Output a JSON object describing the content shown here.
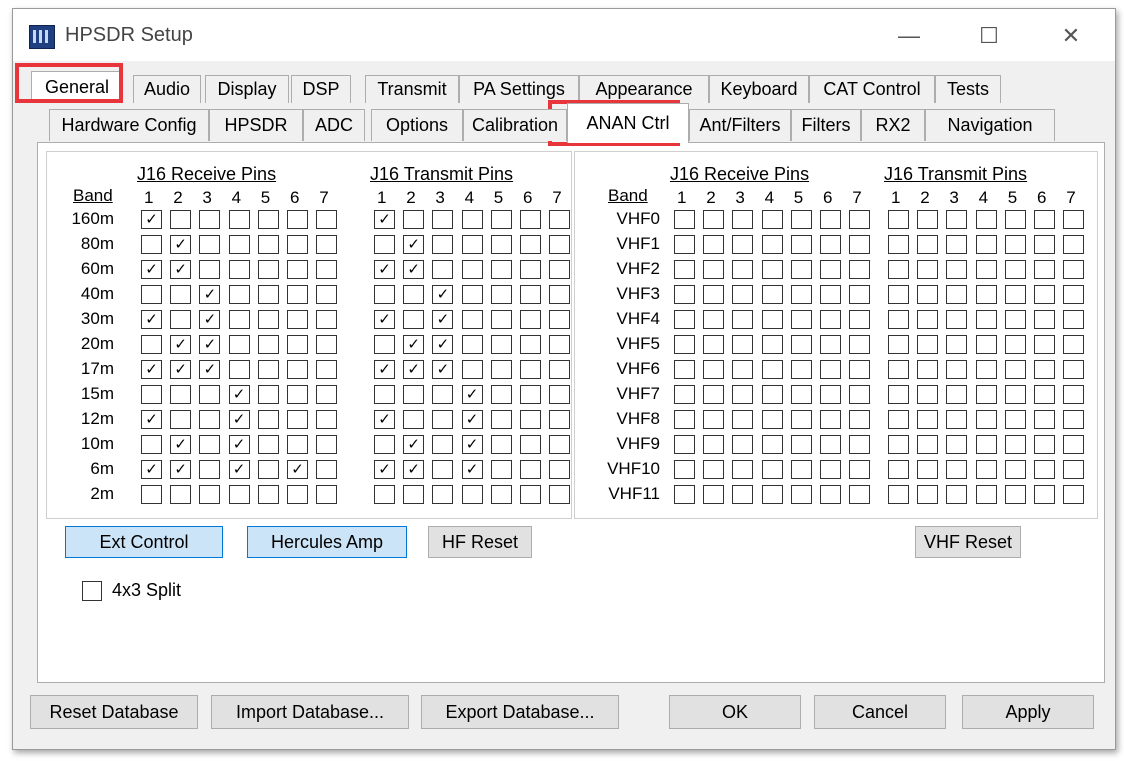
{
  "window": {
    "title": "HPSDR Setup",
    "minimize": "—",
    "maximize": "☐",
    "close": "✕"
  },
  "tabs_row1": [
    {
      "label": "General",
      "selected": true
    },
    {
      "label": "Audio"
    },
    {
      "label": "Display"
    },
    {
      "label": "DSP"
    },
    {
      "label": "Transmit"
    },
    {
      "label": "PA Settings"
    },
    {
      "label": "Appearance"
    },
    {
      "label": "Keyboard"
    },
    {
      "label": "CAT Control"
    },
    {
      "label": "Tests"
    }
  ],
  "tabs_row2": [
    {
      "label": "Hardware Config"
    },
    {
      "label": "HPSDR"
    },
    {
      "label": "ADC"
    },
    {
      "label": "Options"
    },
    {
      "label": "Calibration"
    },
    {
      "label": "ANAN Ctrl",
      "selected": true
    },
    {
      "label": "Ant/Filters"
    },
    {
      "label": "Filters"
    },
    {
      "label": "RX2"
    },
    {
      "label": "Navigation"
    }
  ],
  "hf": {
    "receive_title": "J16 Receive Pins",
    "transmit_title": "J16 Transmit Pins",
    "band_header": "Band",
    "pins": [
      "1",
      "2",
      "3",
      "4",
      "5",
      "6",
      "7"
    ],
    "bands": [
      {
        "name": "160m",
        "rx": [
          1,
          0,
          0,
          0,
          0,
          0,
          0
        ],
        "tx": [
          1,
          0,
          0,
          0,
          0,
          0,
          0
        ]
      },
      {
        "name": "80m",
        "rx": [
          0,
          1,
          0,
          0,
          0,
          0,
          0
        ],
        "tx": [
          0,
          1,
          0,
          0,
          0,
          0,
          0
        ]
      },
      {
        "name": "60m",
        "rx": [
          1,
          1,
          0,
          0,
          0,
          0,
          0
        ],
        "tx": [
          1,
          1,
          0,
          0,
          0,
          0,
          0
        ]
      },
      {
        "name": "40m",
        "rx": [
          0,
          0,
          1,
          0,
          0,
          0,
          0
        ],
        "tx": [
          0,
          0,
          1,
          0,
          0,
          0,
          0
        ]
      },
      {
        "name": "30m",
        "rx": [
          1,
          0,
          1,
          0,
          0,
          0,
          0
        ],
        "tx": [
          1,
          0,
          1,
          0,
          0,
          0,
          0
        ]
      },
      {
        "name": "20m",
        "rx": [
          0,
          1,
          1,
          0,
          0,
          0,
          0
        ],
        "tx": [
          0,
          1,
          1,
          0,
          0,
          0,
          0
        ]
      },
      {
        "name": "17m",
        "rx": [
          1,
          1,
          1,
          0,
          0,
          0,
          0
        ],
        "tx": [
          1,
          1,
          1,
          0,
          0,
          0,
          0
        ]
      },
      {
        "name": "15m",
        "rx": [
          0,
          0,
          0,
          1,
          0,
          0,
          0
        ],
        "tx": [
          0,
          0,
          0,
          1,
          0,
          0,
          0
        ]
      },
      {
        "name": "12m",
        "rx": [
          1,
          0,
          0,
          1,
          0,
          0,
          0
        ],
        "tx": [
          1,
          0,
          0,
          1,
          0,
          0,
          0
        ]
      },
      {
        "name": "10m",
        "rx": [
          0,
          1,
          0,
          1,
          0,
          0,
          0
        ],
        "tx": [
          0,
          1,
          0,
          1,
          0,
          0,
          0
        ]
      },
      {
        "name": "6m",
        "rx": [
          1,
          1,
          0,
          1,
          0,
          1,
          0
        ],
        "tx": [
          1,
          1,
          0,
          1,
          0,
          0,
          0
        ]
      },
      {
        "name": "2m",
        "rx": [
          0,
          0,
          0,
          0,
          0,
          0,
          0
        ],
        "tx": [
          0,
          0,
          0,
          0,
          0,
          0,
          0
        ]
      }
    ]
  },
  "vhf": {
    "receive_title": "J16 Receive Pins",
    "transmit_title": "J16 Transmit Pins",
    "band_header": "Band",
    "pins": [
      "1",
      "2",
      "3",
      "4",
      "5",
      "6",
      "7"
    ],
    "bands": [
      "VHF0",
      "VHF1",
      "VHF2",
      "VHF3",
      "VHF4",
      "VHF5",
      "VHF6",
      "VHF7",
      "VHF8",
      "VHF9",
      "VHF10",
      "VHF11"
    ]
  },
  "buttons": {
    "ext_control": "Ext Control",
    "hercules_amp": "Hercules Amp",
    "hf_reset": "HF Reset",
    "vhf_reset": "VHF Reset"
  },
  "split": {
    "label": "4x3 Split",
    "checked": false
  },
  "footer": {
    "reset_db": "Reset Database",
    "import_db": "Import Database...",
    "export_db": "Export Database...",
    "ok": "OK",
    "cancel": "Cancel",
    "apply": "Apply"
  },
  "colors": {
    "highlight": "#e8353b",
    "active_button": "#cce4f7"
  }
}
